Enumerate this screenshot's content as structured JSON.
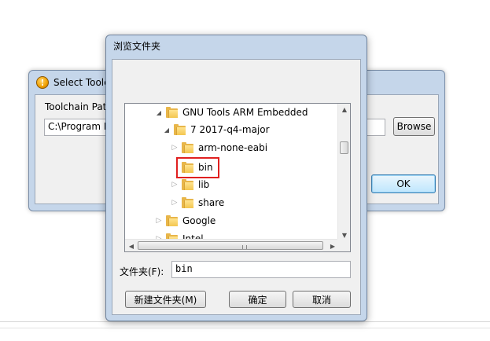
{
  "back_dialog": {
    "title": "Select Toolc",
    "toolchain_label": "Toolchain Pat",
    "path_value": "C:\\Program F",
    "browse_label": "Browse",
    "ok_label": "OK"
  },
  "browse_dialog": {
    "title": "浏览文件夹",
    "tree": [
      {
        "label": "GNU Tools ARM Embedded",
        "expanded": true
      },
      {
        "label": "7 2017-q4-major",
        "expanded": true
      },
      {
        "label": "arm-none-eabi",
        "expanded": false
      },
      {
        "label": "bin",
        "selected": true
      },
      {
        "label": "lib",
        "expanded": false
      },
      {
        "label": "share",
        "expanded": false
      },
      {
        "label": "Google",
        "expanded": false
      },
      {
        "label": "Intel",
        "expanded": false
      }
    ],
    "folder_label": "文件夹(F):",
    "folder_value": "bin",
    "new_folder_label": "新建文件夹(M)",
    "ok_label": "确定",
    "cancel_label": "取消"
  },
  "colors": {
    "highlight_border": "#e02020",
    "folder": "#e8b64a"
  }
}
